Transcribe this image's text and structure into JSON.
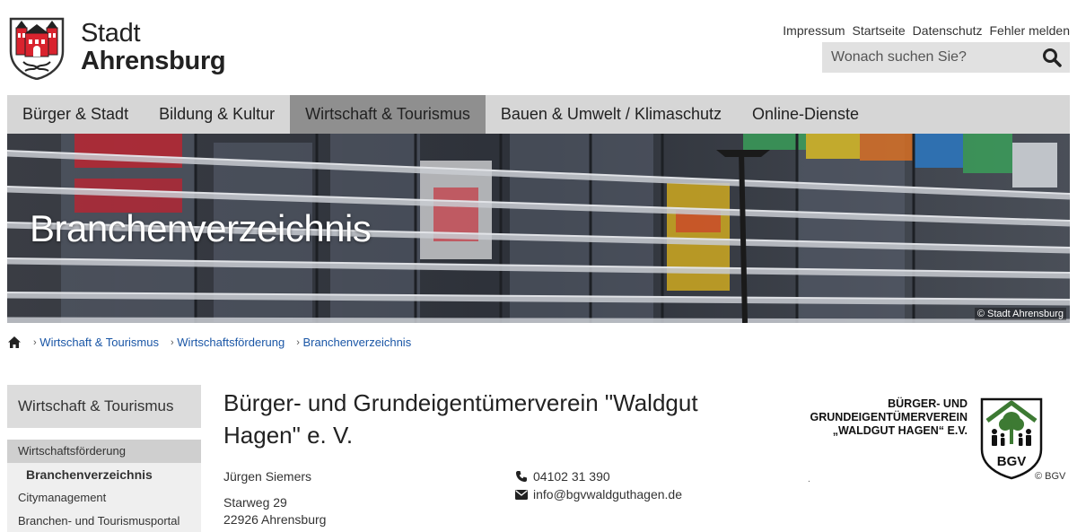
{
  "site": {
    "name_line1": "Stadt",
    "name_line2": "Ahrensburg"
  },
  "meta_links": [
    "Impressum",
    "Startseite",
    "Datenschutz",
    "Fehler melden"
  ],
  "search": {
    "placeholder": "Wonach suchen Sie?",
    "icon": "search-icon"
  },
  "nav": {
    "items": [
      "Bürger & Stadt",
      "Bildung & Kultur",
      "Wirtschaft & Tourismus",
      "Bauen & Umwelt / Klimaschutz",
      "Online-Dienste"
    ],
    "active": "Wirtschaft & Tourismus"
  },
  "hero": {
    "title": "Branchenverzeichnis",
    "credit": "© Stadt Ahrensburg"
  },
  "breadcrumb": {
    "home_icon": "home-icon",
    "items": [
      "Wirtschaft & Tourismus",
      "Wirtschaftsförderung",
      "Branchenverzeichnis"
    ]
  },
  "sidebar": {
    "title": "Wirtschaft & Tourismus",
    "items": [
      "Wirtschaftsförderung",
      "Branchenverzeichnis",
      "Citymanagement",
      "Branchen- und Tourismusportal"
    ]
  },
  "entry": {
    "title": "Bürger- und Grundeigentümerverein \"Waldgut Hagen\" e. V.",
    "contact_name": "Jürgen Siemers",
    "street": "Starweg 29",
    "city": "22926 Ahrensburg",
    "phone": "04102 31 390",
    "email": "info@bgvwaldguthagen.de",
    "phone_icon": "phone-icon",
    "email_icon": "envelope-icon"
  },
  "bgv_logo": {
    "text_line1": "BÜRGER- UND",
    "text_line2": "GRUNDEIGENTÜMERVEREIN",
    "text_line3": "„WALDGUT HAGEN“ E.V.",
    "emblem_text": "BGV",
    "credit": "© BGV",
    "caption": "."
  },
  "colors": {
    "nav_bg": "#d6d6d6",
    "nav_active": "#8f8f8f",
    "link": "#1a56a6",
    "search_bg": "#e1e1e1",
    "bgv_green": "#3d7a33"
  }
}
